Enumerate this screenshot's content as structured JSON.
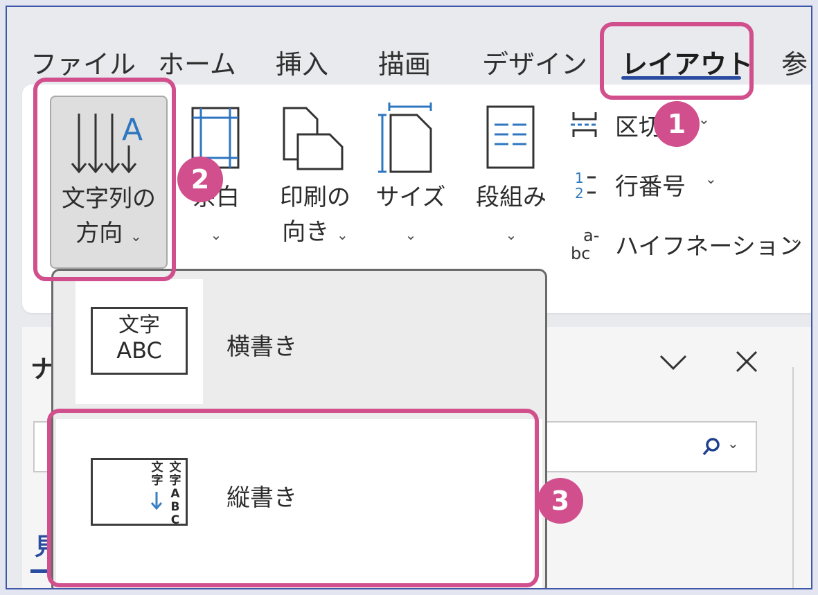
{
  "tabs": [
    {
      "label": "ファイル"
    },
    {
      "label": "ホーム"
    },
    {
      "label": "挿入"
    },
    {
      "label": "描画"
    },
    {
      "label": "デザイン"
    },
    {
      "label": "レイアウト",
      "active": true
    },
    {
      "label": "参"
    }
  ],
  "ribbon": {
    "text_direction": {
      "line1": "文字列の",
      "line2": "方向",
      "icon_letter": "A"
    },
    "margins": {
      "label": "余白"
    },
    "orientation": {
      "line1": "印刷の",
      "line2": "向き"
    },
    "size": {
      "label": "サイズ"
    },
    "columns": {
      "label": "段組み"
    },
    "breaks": {
      "label": "区切り"
    },
    "line_numbers": {
      "label": "行番号",
      "icon_text": "1 2"
    },
    "hyphenation": {
      "label": "ハイフネーション",
      "icon_text": "a- bc"
    }
  },
  "dropdown": {
    "items": [
      {
        "label": "横書き",
        "thumb_line1": "文字",
        "thumb_line2": "ABC"
      },
      {
        "label": "縦書き",
        "thumb_col1": "文字ABC",
        "thumb_col2": "文字"
      }
    ]
  },
  "nav_pane": {
    "title_partial": "ナ",
    "heading_partial": "見"
  },
  "callouts": {
    "badge1": "1",
    "badge2": "2",
    "badge3": "3"
  },
  "colors": {
    "callout": "#d04f8c",
    "accent_underline": "#2a4ca0",
    "frame_border": "#3f58a8",
    "arrow_blue": "#3a7fc1"
  }
}
